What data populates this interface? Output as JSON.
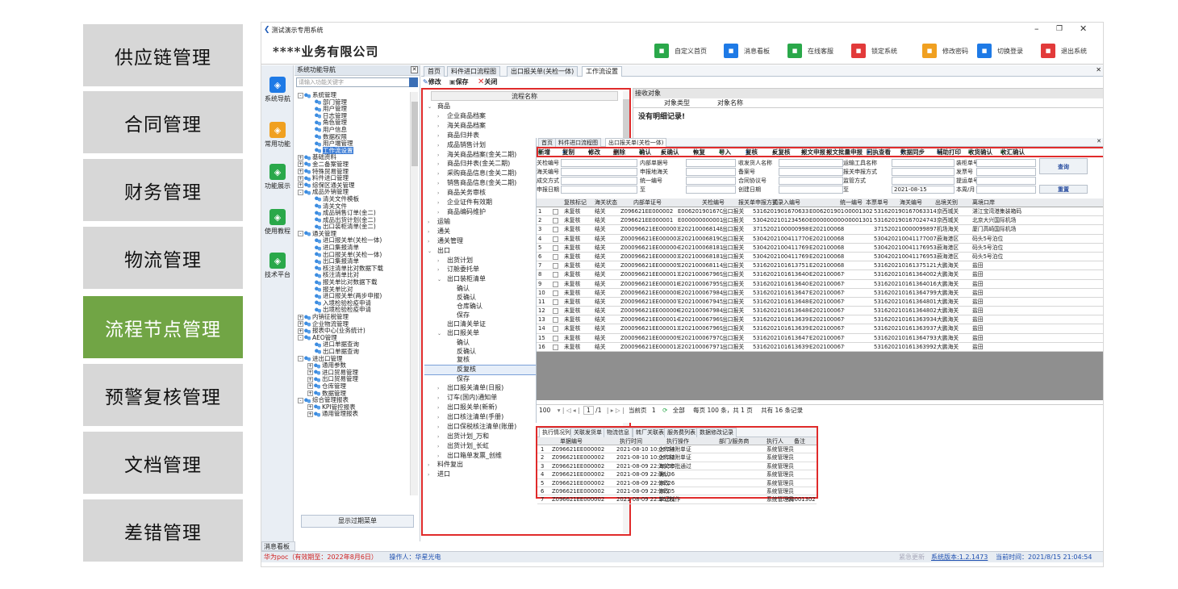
{
  "categories": [
    {
      "label": "供应链管理",
      "active": false
    },
    {
      "label": "合同管理",
      "active": false
    },
    {
      "label": "财务管理",
      "active": false
    },
    {
      "label": "物流管理",
      "active": false
    },
    {
      "label": "流程节点管理",
      "active": true
    },
    {
      "label": "预警复核管理",
      "active": false
    },
    {
      "label": "文档管理",
      "active": false
    },
    {
      "label": "差错管理",
      "active": false
    }
  ],
  "window": {
    "title": "测试演示专用系统",
    "company": "****业务有限公司",
    "buttons": [
      {
        "label": "自定义首页",
        "color": "#2aa84a",
        "icon": "home-grid-icon"
      },
      {
        "label": "消息看板",
        "color": "#1e7ae6",
        "icon": "bell-icon"
      },
      {
        "label": "在线客服",
        "color": "#2aa84a",
        "icon": "headset-icon"
      },
      {
        "label": "锁定系统",
        "color": "#e23a3a",
        "icon": "lock-icon"
      },
      {
        "label": "修改密码",
        "color": "#f0a020",
        "icon": "edit-icon"
      },
      {
        "label": "切换登录",
        "color": "#1e7ae6",
        "icon": "user-switch-icon"
      },
      {
        "label": "退出系统",
        "color": "#e23a3a",
        "icon": "power-icon"
      }
    ]
  },
  "iconbar": [
    {
      "label": "系统导航",
      "color": "#1e7ae6"
    },
    {
      "label": "常用功能",
      "color": "#f0a020"
    },
    {
      "label": "功能展示",
      "color": "#2aa84a"
    },
    {
      "label": "使用教程",
      "color": "#2aa84a"
    },
    {
      "label": "技术平台",
      "color": "#2aa84a"
    }
  ],
  "nav": {
    "title": "系统功能导航",
    "search_placeholder": "请输入功能关键字",
    "tree": [
      {
        "t": "系统管理",
        "l": 0,
        "x": "-"
      },
      {
        "t": "部门管理",
        "l": 1
      },
      {
        "t": "用户管理",
        "l": 1
      },
      {
        "t": "日志管理",
        "l": 1
      },
      {
        "t": "角色管理",
        "l": 1
      },
      {
        "t": "用户信息",
        "l": 1
      },
      {
        "t": "数据权限",
        "l": 1
      },
      {
        "t": "用户端管理",
        "l": 1
      },
      {
        "t": "工作流设置",
        "l": 1,
        "sel": true
      },
      {
        "t": "基础资料",
        "l": 0,
        "x": "+"
      },
      {
        "t": "金二备案管理",
        "l": 0,
        "x": "+"
      },
      {
        "t": "特殊贸易管理",
        "l": 0,
        "x": "+"
      },
      {
        "t": "料件进口管理",
        "l": 0,
        "x": "+"
      },
      {
        "t": "综保区通关管理",
        "l": 0,
        "x": "+"
      },
      {
        "t": "成品外销管理",
        "l": 0,
        "x": "-"
      },
      {
        "t": "清关文件模板",
        "l": 1
      },
      {
        "t": "清关文件",
        "l": 1
      },
      {
        "t": "成品销售订单(金二)",
        "l": 1
      },
      {
        "t": "成品出货计划(金二)",
        "l": 1
      },
      {
        "t": "出口装柜清单(金二)",
        "l": 1
      },
      {
        "t": "通关管理",
        "l": 0,
        "x": "-"
      },
      {
        "t": "进口报关单(关检一体)",
        "l": 1
      },
      {
        "t": "进口集报清单",
        "l": 1
      },
      {
        "t": "出口报关单(关检一体)",
        "l": 1
      },
      {
        "t": "出口集报清单",
        "l": 1
      },
      {
        "t": "核注清单比对数据下载",
        "l": 1
      },
      {
        "t": "核注清单比对",
        "l": 1
      },
      {
        "t": "报关单比对数据下载",
        "l": 1
      },
      {
        "t": "报关单比对",
        "l": 1
      },
      {
        "t": "进口报关单(两步申报)",
        "l": 1
      },
      {
        "t": "入境检验检疫申请",
        "l": 1
      },
      {
        "t": "出境检验检疫申请",
        "l": 1
      },
      {
        "t": "内销征税管理",
        "l": 0,
        "x": "+"
      },
      {
        "t": "企业物流管理",
        "l": 0,
        "x": "+"
      },
      {
        "t": "报表中心(业务统计)",
        "l": 0,
        "x": "+"
      },
      {
        "t": "AEO管理",
        "l": 0,
        "x": "-"
      },
      {
        "t": "进口单据查询",
        "l": 1
      },
      {
        "t": "出口单据查询",
        "l": 1
      },
      {
        "t": "进出口管理",
        "l": 0,
        "x": "-"
      },
      {
        "t": "通用参数",
        "l": 1,
        "x": "+"
      },
      {
        "t": "进口贸易管理",
        "l": 1,
        "x": "+"
      },
      {
        "t": "出口贸易管理",
        "l": 1,
        "x": "+"
      },
      {
        "t": "仓库管理",
        "l": 1,
        "x": "+"
      },
      {
        "t": "数据管理",
        "l": 1,
        "x": "+"
      },
      {
        "t": "综合管理报表",
        "l": 0,
        "x": "-"
      },
      {
        "t": "KPI管控报表",
        "l": 1,
        "x": "+"
      },
      {
        "t": "通用管理报表",
        "l": 1,
        "x": "+"
      }
    ],
    "expired_menu_btn": "显示过期菜单",
    "msg_board": "消息看板"
  },
  "main_tabs": [
    "首页",
    "料件进口流程图",
    "出口报关单(关检一体)",
    "工作流设置"
  ],
  "toolbar1": [
    "修改",
    "保存",
    "关闭"
  ],
  "flow": {
    "header": "流程名称",
    "items": [
      {
        "t": "商品",
        "l": 0,
        "a": "⌄"
      },
      {
        "t": "企业商品档案",
        "l": 1,
        "a": "›"
      },
      {
        "t": "海关商品档案",
        "l": 1,
        "a": "›"
      },
      {
        "t": "商品归并表",
        "l": 1,
        "a": "›"
      },
      {
        "t": "成品销售计划",
        "l": 1,
        "a": "›"
      },
      {
        "t": "海关商品档案(金关二期)",
        "l": 1,
        "a": "›"
      },
      {
        "t": "商品归并表(金关二期)",
        "l": 1,
        "a": "›"
      },
      {
        "t": "采购商品信息(金关二期)",
        "l": 1,
        "a": "›"
      },
      {
        "t": "销售商品信息(金关二期)",
        "l": 1,
        "a": "›"
      },
      {
        "t": "商品关务审核",
        "l": 1,
        "a": "›"
      },
      {
        "t": "企业证件有效期",
        "l": 1,
        "a": "›"
      },
      {
        "t": "商品编码维护",
        "l": 1,
        "a": "›"
      },
      {
        "t": "运输",
        "l": 0,
        "a": "›"
      },
      {
        "t": "通关",
        "l": 0,
        "a": "›"
      },
      {
        "t": "通关管理",
        "l": 0,
        "a": "›"
      },
      {
        "t": "出口",
        "l": 0,
        "a": "⌄"
      },
      {
        "t": "出货计划",
        "l": 1,
        "a": "›"
      },
      {
        "t": "订舱委托单",
        "l": 1,
        "a": "›"
      },
      {
        "t": "出口装柜清单",
        "l": 1,
        "a": "⌄"
      },
      {
        "t": "确认",
        "l": 2,
        "a": ""
      },
      {
        "t": "反确认",
        "l": 2,
        "a": ""
      },
      {
        "t": "仓库确认",
        "l": 2,
        "a": ""
      },
      {
        "t": "保存",
        "l": 2,
        "a": ""
      },
      {
        "t": "出口清关单证",
        "l": 1,
        "a": ""
      },
      {
        "t": "出口报关单",
        "l": 1,
        "a": "⌄"
      },
      {
        "t": "确认",
        "l": 2,
        "a": ""
      },
      {
        "t": "反确认",
        "l": 2,
        "a": ""
      },
      {
        "t": "复核",
        "l": 2,
        "a": ""
      },
      {
        "t": "反复核",
        "l": 2,
        "a": "",
        "sel": true
      },
      {
        "t": "保存",
        "l": 2,
        "a": ""
      },
      {
        "t": "出口报关清单(日报)",
        "l": 1,
        "a": "›"
      },
      {
        "t": "订车(国内)通知单",
        "l": 1,
        "a": "›"
      },
      {
        "t": "出口报关单(新新)",
        "l": 1,
        "a": "›"
      },
      {
        "t": "出口核注清单(手册)",
        "l": 1,
        "a": "›"
      },
      {
        "t": "出口保税核注清单(账册)",
        "l": 1,
        "a": "›"
      },
      {
        "t": "出货计划_万和",
        "l": 1,
        "a": "›"
      },
      {
        "t": "出货计划_长虹",
        "l": 1,
        "a": "›"
      },
      {
        "t": "出口箱单发票_创维",
        "l": 1,
        "a": "›"
      },
      {
        "t": "料件复出",
        "l": 0,
        "a": "›"
      },
      {
        "t": "进口",
        "l": 0,
        "a": "›"
      }
    ]
  },
  "recv": {
    "title": "接收对象",
    "col1": "对象类型",
    "col2": "对象名称",
    "empty": "没有明细记录!"
  },
  "sub": {
    "tabs": [
      "首页",
      "料件进口流程图",
      "出口报关单(关检一体)"
    ],
    "toolbar": [
      "新增",
      "复制",
      "修改",
      "删除",
      "确认",
      "反确认",
      "恢复",
      "导入",
      "复核",
      "反复核",
      "报文申报",
      "报文批量申报",
      "回执查看",
      "数据同步",
      "辅助打印",
      "收货确认",
      "收汇确认"
    ],
    "filters": {
      "r1": [
        "关检编号",
        "内部单据号",
        "收发货人名称",
        "运输工具名称",
        "装柜单号"
      ],
      "r2": [
        "海关编号",
        "申报地海关",
        "备案号",
        "报关申报方式",
        "发票号"
      ],
      "r3": [
        "成交方式",
        "统一编号",
        "合同协议号",
        "监管方式",
        "提运单号"
      ],
      "r4": [
        "申报日期",
        "至",
        "创建日期",
        "至",
        "本周/月"
      ],
      "date_to": "2021-08-15",
      "query": "查询",
      "reset": "重置"
    },
    "columns": [
      "",
      "复核标记",
      "海关状态",
      "内部单证号",
      "关检编号",
      "报关单申报方式",
      "预录入编号",
      "统一编号",
      "本票单号",
      "海关编号",
      "出境关别",
      "离境口岸"
    ],
    "rows": [
      [
        "1",
        "未复核",
        "结关",
        "Z096621EE000002",
        "E0062019016706331​4",
        "出口报关",
        "531620190167063314",
        "E00620190167063314",
        "00001302",
        "531620190167063314",
        "京西城关",
        "湛江宝湾港集装箱码"
      ],
      [
        "2",
        "未复核",
        "结关",
        "Z096621EE000001",
        "E000000000001",
        "出口报关",
        "530420210123456000",
        "E000000000001",
        "00001301",
        "531620190167024743",
        "京西城关",
        "北京大兴国际机场"
      ],
      [
        "3",
        "未复核",
        "结关",
        "Z00096621EE000001",
        "E2021000681480221",
        "出口报关",
        "371520210000099897",
        "E2021000681480221",
        "",
        "371520210000099897",
        "机场海关",
        "厦门高崎国际机场"
      ],
      [
        "4",
        "未复核",
        "结关",
        "Z00096621EE000002",
        "E2021000681902541",
        "出口报关",
        "530420210041177007",
        "E2021000681902541",
        "",
        "530420210041177007",
        "蔚海港区",
        "码头5号泊位"
      ],
      [
        "5",
        "未复核",
        "结关",
        "Z00096621EE000004",
        "E2021000681813301",
        "出口报关",
        "530420210041176953",
        "E2021000681813301",
        "",
        "530420210041176953",
        "蔚海港区",
        "码头5号泊位"
      ],
      [
        "6",
        "未复核",
        "结关",
        "Z00096621EE000003",
        "E2021000681813431",
        "出口报关",
        "530420210041176953",
        "E2021000681813431",
        "",
        "530420210041176953",
        "蔚海港区",
        "码头5号泊位"
      ],
      [
        "7",
        "未复核",
        "结关",
        "Z00096621EE000005",
        "E2021000681148941",
        "出口报关",
        "531620210161375121",
        "E2021000681148941",
        "",
        "531620210161375121",
        "大鹏海关",
        "盐田"
      ],
      [
        "8",
        "未复核",
        "结关",
        "Z00096621EE000011",
        "E2021000679695921",
        "出口报关",
        "531620210161364002",
        "E2021000679695921",
        "",
        "531620210161364002",
        "大鹏海关",
        "盐田"
      ],
      [
        "9",
        "未复核",
        "结关",
        "Z00096621EE000010",
        "E2021000679590515",
        "出口报关",
        "531620210161364016",
        "E2021000679590515",
        "",
        "531620210161364016",
        "大鹏海关",
        "盐田"
      ],
      [
        "10",
        "未复核",
        "结关",
        "Z00096621EE000008",
        "E2021000679841607",
        "出口报关",
        "531620210161364799",
        "E2021000679841607",
        "",
        "531620210161364799",
        "大鹏海关",
        "盐田"
      ],
      [
        "11",
        "未复核",
        "结关",
        "Z00096621EE000007",
        "E2021000679459649",
        "出口报关",
        "531620210161364801",
        "E2021000679459649",
        "",
        "531620210161364801",
        "大鹏海关",
        "盐田"
      ],
      [
        "12",
        "未复核",
        "结关",
        "Z00096621EE000006",
        "E2021000679840299",
        "出口报关",
        "531620210161364802",
        "E2021000679840299",
        "",
        "531620210161364802",
        "大鹏海关",
        "盐田"
      ],
      [
        "13",
        "未复核",
        "结关",
        "Z00096621EE000014",
        "E2021000679690455",
        "出口报关",
        "531620210161363934",
        "E2021000679690455",
        "",
        "531620210161363934",
        "大鹏海关",
        "盐田"
      ],
      [
        "14",
        "未复核",
        "结关",
        "Z00096621EE000013",
        "E2021000679690407",
        "出口报关",
        "531620210161363937",
        "E2021000679690407",
        "",
        "531620210161363937",
        "大鹏海关",
        "盐田"
      ],
      [
        "15",
        "未复核",
        "结关",
        "Z00096621EE000009",
        "E2021000679703013",
        "出口报关",
        "531620210161364793",
        "E2021000679703013",
        "",
        "531620210161364793",
        "大鹏海关",
        "盐田"
      ],
      [
        "16",
        "未复核",
        "结关",
        "Z00096621EE000012",
        "E2021000679710207",
        "出口报关",
        "531620210161363992",
        "E2021000679710207",
        "",
        "531620210161363992",
        "大鹏海关",
        "盐田"
      ]
    ],
    "pager": {
      "size": "100",
      "page": "1",
      "pages": "/1",
      "cur_label": "当前页",
      "cur": "1",
      "all": "全部",
      "info": "每页 100 条，共 1 页",
      "total": "共有 16 条记录"
    }
  },
  "exec": {
    "tabs": [
      "执行情况列表",
      "关联发货单",
      "物流信息",
      "转厂关联表",
      "服务费列表",
      "数据修改记录"
    ],
    "columns": [
      "单据编号",
      "执行时间",
      "执行操作",
      "部门/服务商",
      "执行人",
      "备注"
    ],
    "rows": [
      [
        "1",
        "Z096621EE000002",
        "2021-08-10 10:06:54",
        "上传随附单证",
        "",
        "系统管理员",
        ""
      ],
      [
        "2",
        "Z096621EE000002",
        "2021-08-10 10:06:32",
        "上传随附单证",
        "",
        "系统管理员",
        ""
      ],
      [
        "3",
        "Z096621EE000002",
        "2021-08-09 22:38:50",
        "海关审批通过",
        "",
        "系统管理员",
        ""
      ],
      [
        "4",
        "Z096621EE000002",
        "2021-08-09 22:38:36",
        "确认",
        "",
        "系统管理员",
        ""
      ],
      [
        "5",
        "Z096621EE000002",
        "2021-08-09 22:38:26",
        "修改",
        "",
        "系统管理员",
        ""
      ],
      [
        "6",
        "Z096621EE000002",
        "2021-08-09 22:38:05",
        "修改",
        "",
        "系统管理员",
        ""
      ],
      [
        "7",
        "Z096621EE000002",
        "2021-08-09 22:36:51",
        "单证制作",
        "",
        "系统管理员",
        "00001302"
      ]
    ]
  },
  "status": {
    "left": "华为poc（有效期至：2022年8月6日）",
    "operator": "操作人：华星光电",
    "right_dim": "紧急更新",
    "version": "系统版本:1.2.1473",
    "time": "当前时间：2021/8/15 21:04:54"
  }
}
